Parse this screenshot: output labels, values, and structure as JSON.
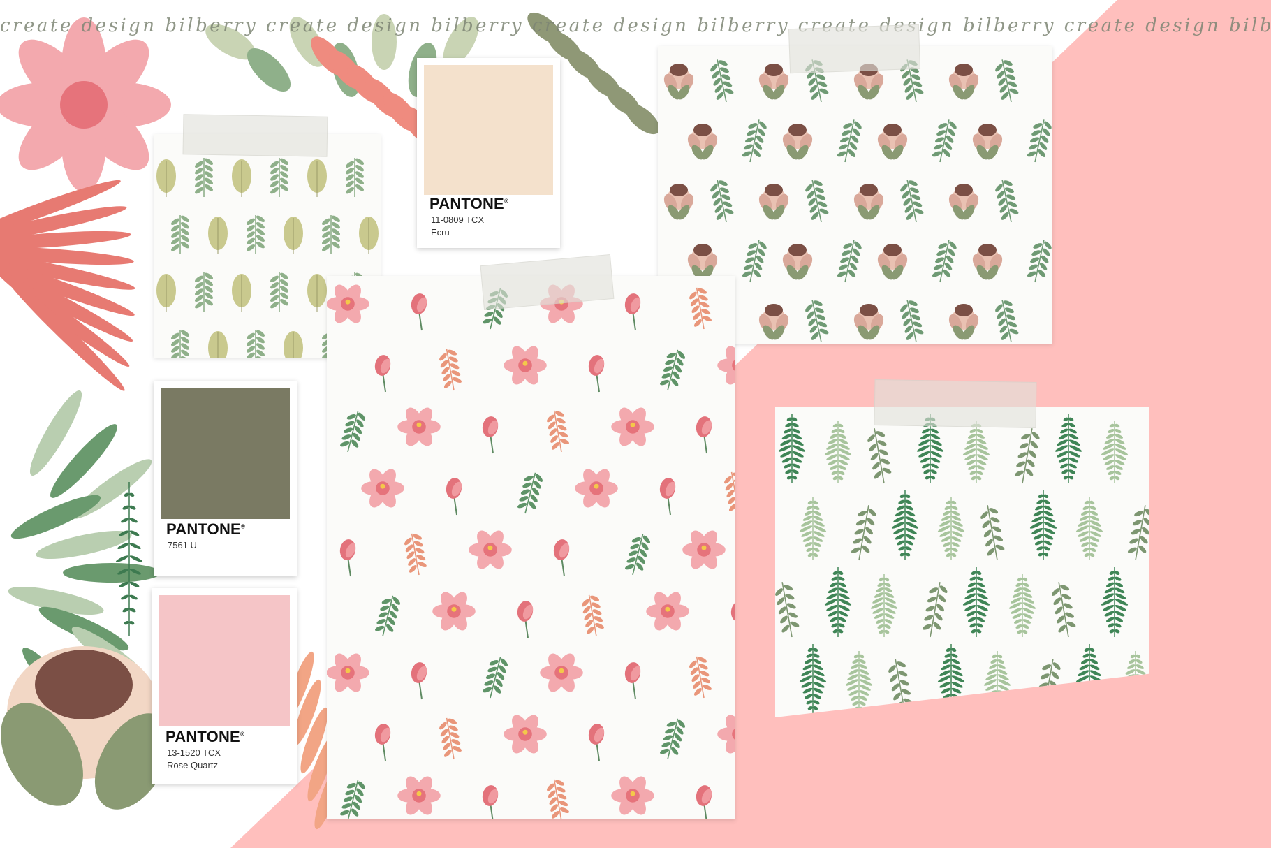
{
  "watermark": {
    "text": "create design bilberry create design bilberry create design bilberry create design bilberry create design bilberry create design bilberry"
  },
  "colors": {
    "background_pink": "#ffbfbd",
    "leaf_green": "#6a9a6e",
    "dark_green": "#3d7a50",
    "olive": "#7a7a63",
    "coral": "#e77a72",
    "blush": "#f1a9a6",
    "ecru": "#f4e1cc",
    "rose_quartz": "#f5c5c7"
  },
  "swatches": [
    {
      "brand": "PANTONE",
      "code": "11-0809 TCX",
      "name": "Ecru",
      "color": "#f4e1cc"
    },
    {
      "brand": "PANTONE",
      "code": "7561 U",
      "name": "",
      "color": "#7a7a63"
    },
    {
      "brand": "PANTONE",
      "code": "13-1520 TCX",
      "name": "Rose Quartz",
      "color": "#f5c5c7"
    }
  ],
  "patterns": [
    {
      "name": "leaf-pattern-small",
      "motif": "olive leaves and palm sprigs"
    },
    {
      "name": "protea-pattern",
      "motif": "protea flowers with green sprigs"
    },
    {
      "name": "magnolia-pattern",
      "motif": "pink magnolia, tulips and leaves"
    },
    {
      "name": "fern-pattern",
      "motif": "ferns and eucalyptus branches"
    }
  ]
}
